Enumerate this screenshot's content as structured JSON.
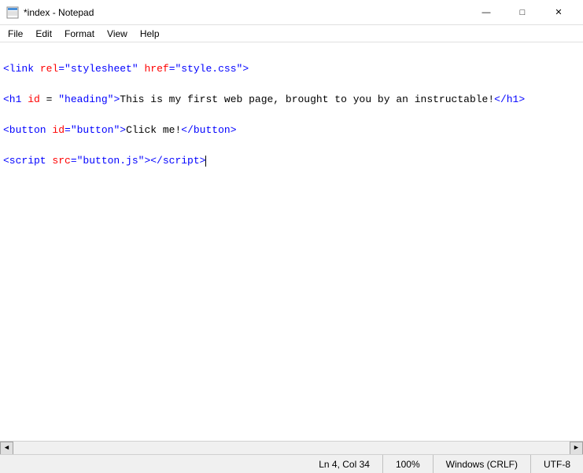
{
  "titleBar": {
    "title": "*index - Notepad",
    "minimize": "—",
    "maximize": "□",
    "close": "✕"
  },
  "menuBar": {
    "items": [
      "File",
      "Edit",
      "Format",
      "View",
      "Help"
    ]
  },
  "editor": {
    "lines": [
      "<link rel=\"stylesheet\" href=\"style.css\">",
      "<h1 id = \"heading\">This is my first web page, brought to you by an instructable!</h1>",
      "<button id=\"button\">Click me!</button>",
      "<script src=\"button.js\"></script>"
    ]
  },
  "statusBar": {
    "position": "Ln 4, Col 34",
    "zoom": "100%",
    "lineEnding": "Windows (CRLF)",
    "encoding": "UTF-8"
  }
}
